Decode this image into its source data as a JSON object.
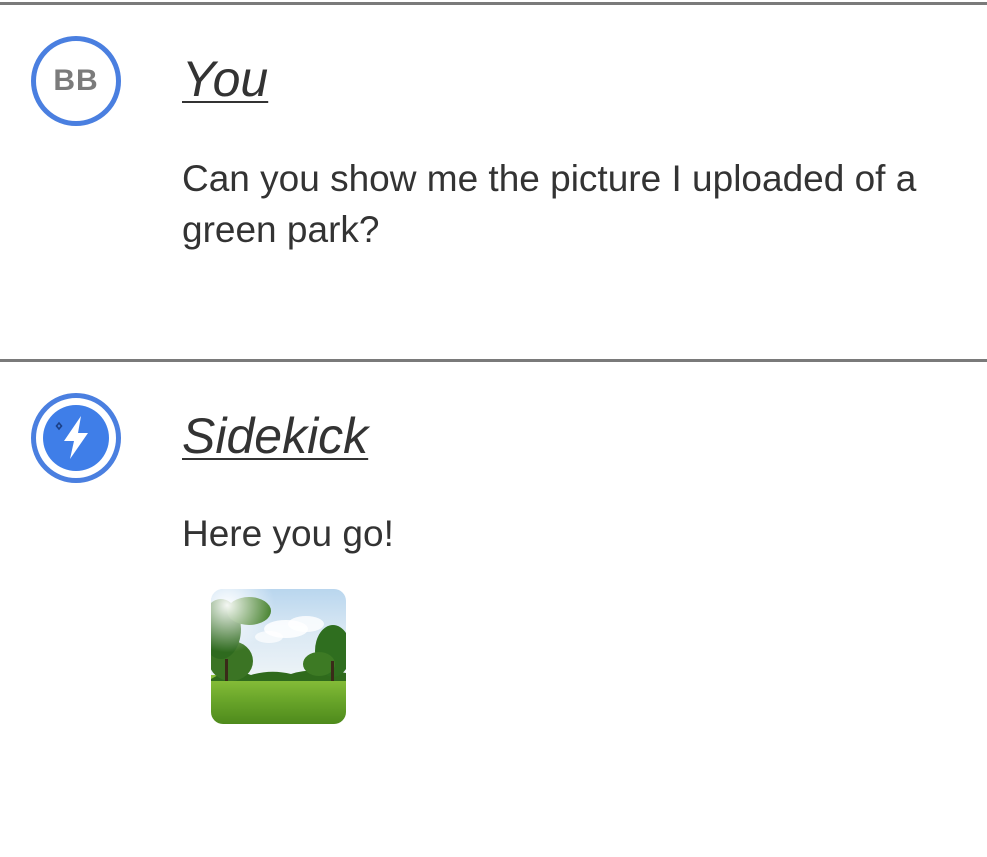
{
  "conversation": {
    "messages": [
      {
        "role": "user",
        "avatar_initials": "BB",
        "sender": "You",
        "text": "Can you show me the picture I uploaded of a green park?"
      },
      {
        "role": "assistant",
        "avatar_icon": "lightning-bolt-icon",
        "sender": "Sidekick",
        "text": "Here you go!",
        "attachment": {
          "type": "image",
          "subject": "green park"
        }
      }
    ]
  },
  "colors": {
    "accent": "#4a7fe0",
    "divider": "#7a7a7a",
    "text": "#333333",
    "initials": "#7b7b7b"
  }
}
